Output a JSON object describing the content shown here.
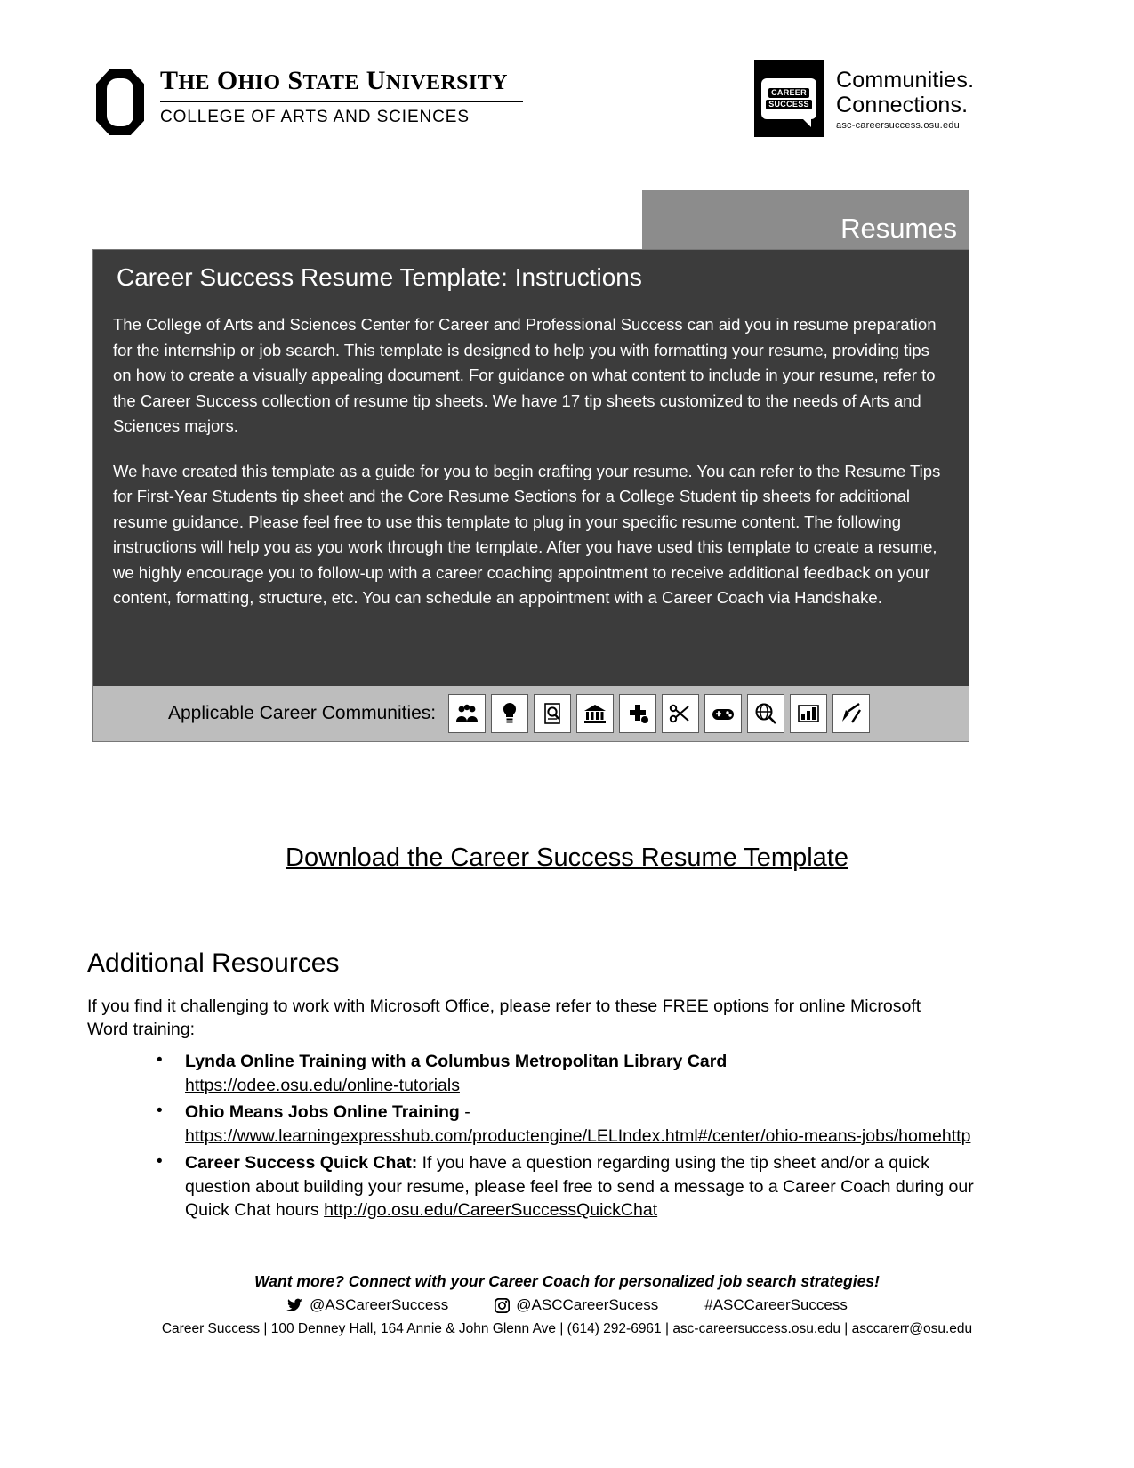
{
  "header": {
    "university_name": "THE OHIO STATE UNIVERSITY",
    "college_name": "COLLEGE OF ARTS AND SCIENCES",
    "osu_mark_alt": "osu-block-o-logo",
    "career_success_mark_line1": "CAREER",
    "career_success_mark_line2": "SUCCESS",
    "tagline_line1": "Communities.",
    "tagline_line2": "Connections.",
    "tagline_url": "asc-careersuccess.osu.edu"
  },
  "tab": {
    "label": "Resumes"
  },
  "card": {
    "title": "Career Success Resume Template: Instructions",
    "paragraphs": [
      "The College of Arts and Sciences Center for Career and Professional Success can aid you in resume preparation for the internship or job search. This template is designed to help you with formatting your resume, providing tips on how to create a visually appealing document. For guidance on what content to include in your resume, refer to the Career Success collection of resume tip sheets.  We have 17 tip sheets customized to the needs of Arts and Sciences majors.",
      "We have created this template as a guide for you to begin crafting your resume. You can refer to the Resume Tips for First-Year Students tip sheet and the Core Resume Sections for a College Student tip sheets for additional resume guidance. Please feel free to use this template to plug in your specific resume content. The following instructions will help you as you work through the template. After you have used this template to create a resume, we highly encourage you to follow-up with a career coaching appointment to receive additional feedback on your content, formatting, structure, etc. You can schedule an appointment with a Career Coach via Handshake."
    ],
    "communities_label": "Applicable Career Communities:",
    "community_icons": [
      "people-group-icon",
      "lightbulb-icon",
      "magnifier-document-icon",
      "bank-building-icon",
      "medical-cross-icon",
      "scissors-palette-icon",
      "game-controller-icon",
      "globe-magnifier-icon",
      "chart-growth-icon",
      "paintbrush-pencil-icon"
    ]
  },
  "download": {
    "link_text": "Download the Career Success Resume Template"
  },
  "resources": {
    "heading": "Additional Resources",
    "intro": "If you find it challenging to work with Microsoft Office, please refer to these FREE options for online Microsoft Word training:",
    "items": [
      {
        "title": "Lynda Online Training with a Columbus Metropolitan Library Card",
        "suffix": "",
        "url": "https://odee.osu.edu/online-tutorials",
        "body": ""
      },
      {
        "title": "Ohio Means Jobs Online Training",
        "suffix": " -",
        "url": "https://www.learningexpresshub.com/productengine/LELIndex.html#/center/ohio-means-jobs/homehttp",
        "body": ""
      },
      {
        "title": "Career Success Quick Chat:",
        "suffix": "",
        "url": "http://go.osu.edu/CareerSuccessQuickChat",
        "body": " If you have a question regarding using the tip sheet and/or a quick question about building your resume, please feel free to send a message to a Career Coach during our Quick Chat hours "
      }
    ]
  },
  "footer": {
    "tagline": "Want more? Connect with your Career Coach for personalized job search strategies!",
    "twitter_handle": "@ASCareerSuccess",
    "instagram_handle": "@ASCCareerSucess",
    "hashtag": "#ASCCareerSuccess",
    "address": "Career Success | 100 Denney Hall, 164 Annie & John Glenn Ave | (614) 292-6961 | asc-careersuccess.osu.edu | asccarerr@osu.edu"
  },
  "colors": {
    "card_bg": "#3c3c3c",
    "tab_bg": "#8c8c8c",
    "community_bar_bg": "#bdbdbd",
    "text": "#000000"
  }
}
